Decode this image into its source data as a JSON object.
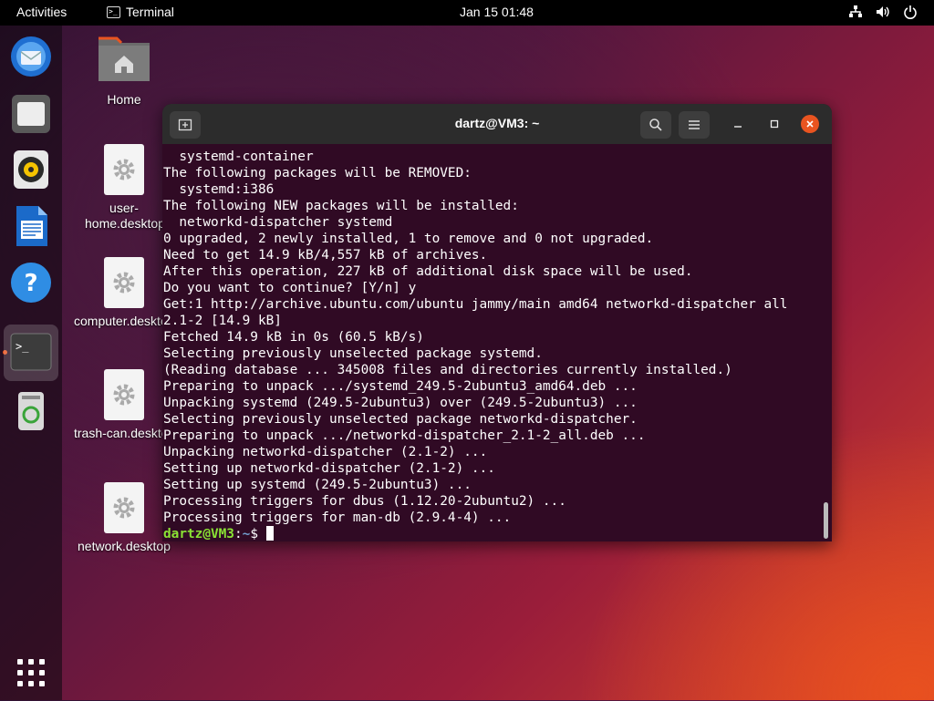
{
  "topbar": {
    "activities": "Activities",
    "app_name": "Terminal",
    "clock": "Jan 15  01:48",
    "tray_icons": [
      "network-icon",
      "volume-icon",
      "power-icon"
    ]
  },
  "dock": {
    "items": [
      {
        "name": "thunderbird",
        "icon": "mail-client-icon"
      },
      {
        "name": "files",
        "icon": "file-manager-icon"
      },
      {
        "name": "rhythmbox",
        "icon": "music-player-icon"
      },
      {
        "name": "writer",
        "icon": "office-writer-icon"
      },
      {
        "name": "help",
        "icon": "help-icon"
      },
      {
        "name": "terminal",
        "icon": "terminal-icon",
        "active": true
      },
      {
        "name": "trash",
        "icon": "trash-icon"
      }
    ],
    "show_apps_icon": "app-grid-icon"
  },
  "desktop": {
    "icons": [
      {
        "label": "Home"
      },
      {
        "label": "user-home.desktop"
      },
      {
        "label": "computer.desktop"
      },
      {
        "label": "trash-can.desktop"
      },
      {
        "label": "network.desktop"
      }
    ]
  },
  "terminal": {
    "title": "dartz@VM3: ~",
    "lines": [
      "  systemd-container",
      "The following packages will be REMOVED:",
      "  systemd:i386",
      "The following NEW packages will be installed:",
      "  networkd-dispatcher systemd",
      "0 upgraded, 2 newly installed, 1 to remove and 0 not upgraded.",
      "Need to get 14.9 kB/4,557 kB of archives.",
      "After this operation, 227 kB of additional disk space will be used.",
      "Do you want to continue? [Y/n] y",
      "Get:1 http://archive.ubuntu.com/ubuntu jammy/main amd64 networkd-dispatcher all",
      "2.1-2 [14.9 kB]",
      "Fetched 14.9 kB in 0s (60.5 kB/s)",
      "Selecting previously unselected package systemd.",
      "(Reading database ... 345008 files and directories currently installed.)",
      "Preparing to unpack .../systemd_249.5-2ubuntu3_amd64.deb ...",
      "Unpacking systemd (249.5-2ubuntu3) over (249.5-2ubuntu3) ...",
      "Selecting previously unselected package networkd-dispatcher.",
      "Preparing to unpack .../networkd-dispatcher_2.1-2_all.deb ...",
      "Unpacking networkd-dispatcher (2.1-2) ...",
      "Setting up networkd-dispatcher (2.1-2) ...",
      "Setting up systemd (249.5-2ubuntu3) ...",
      "Processing triggers for dbus (1.12.20-2ubuntu2) ...",
      "Processing triggers for man-db (2.9.4-4) ..."
    ],
    "prompt_user": "dartz@VM3",
    "prompt_sep": ":",
    "prompt_path": "~",
    "prompt_symbol": "$ "
  }
}
